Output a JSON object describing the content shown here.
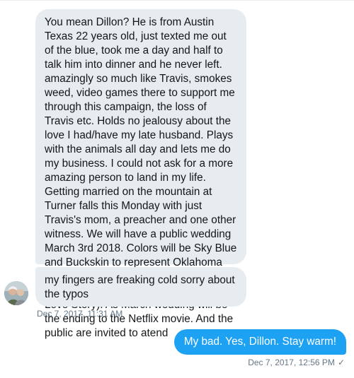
{
  "conversation": {
    "messages": [
      {
        "direction": "received",
        "text": "You mean Dillon? He is from Austin Texas 22 years old, just texted me out of the blue, took me a day and half to talk him into dinner and he never left. amazingly so much like Travis, smokes weed, video games there to support me through this campaign, the loss of Travis etc. Holds no jealousy about the love I had/have my late husband. Plays with the animals all day and lets me do my business. I could not ask for a more amazing person to land in my life. Getting married on the mountain at Turner falls this Monday with just Travis's mom, a preacher and one other witness. We will have a public wedding March 3rd 2018. Colors will be Sky Blue and Buckskin to represent Oklahoma and non-discrimination as a Grubinatoral Candidate. Theme..... (A Love Story). As March wedding will be the ending to the Netflix movie. And the public are invited to atend"
      },
      {
        "direction": "received",
        "text": "my fingers are freaking cold sorry about the typos",
        "timestamp": "Dec 7, 2017, 11:31 AM"
      },
      {
        "direction": "sent",
        "text": "My bad. Yes, Dillon. Stay warm!",
        "timestamp": "Dec 7, 2017, 12:56 PM",
        "status_icon": "check-icon",
        "status_glyph": "✓"
      }
    ]
  },
  "colors": {
    "received_bubble": "#e6ecf0",
    "sent_bubble": "#1da1f2",
    "meta_text": "#657786"
  }
}
